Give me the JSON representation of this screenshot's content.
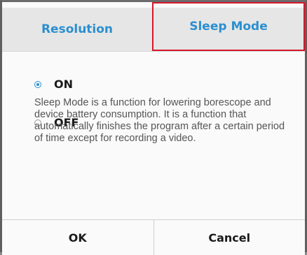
{
  "tabs": [
    {
      "label": "Resolution",
      "selected": false
    },
    {
      "label": "Sleep Mode",
      "selected": true
    }
  ],
  "options": [
    {
      "label": "ON",
      "checked": true
    },
    {
      "label": "OFF",
      "checked": false
    }
  ],
  "description": "Sleep Mode is a function for lowering borescope and device battery consumption. It is a function that automatically finishes the program after a certain period of time except for recording a video.",
  "buttons": {
    "ok_label": "OK",
    "cancel_label": "Cancel"
  },
  "colors": {
    "accent": "#2b8fcf",
    "selected_tab_border": "#d4182b"
  }
}
